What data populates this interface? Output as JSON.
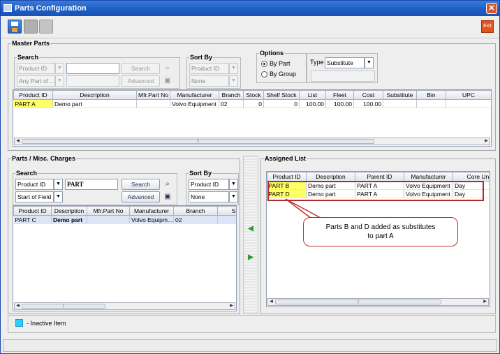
{
  "window": {
    "title": "Parts Configuration",
    "close_glyph": "✕"
  },
  "toolbar": {
    "exit_label": "Exit",
    "icons": [
      "save-icon",
      "print-icon",
      "document-icon"
    ]
  },
  "master": {
    "title": "Master Parts",
    "search": {
      "label": "Search",
      "field": "Product ID",
      "match": "Any Part of ...",
      "value": "",
      "search_btn": "Search",
      "advanced_btn": "Advanced"
    },
    "sort": {
      "label": "Sort By",
      "field": "Product ID",
      "order": "None"
    },
    "options": {
      "label": "Options",
      "by_part": "By Part",
      "by_group": "By Group",
      "type_label": "Type",
      "type_value": "Substitute"
    },
    "columns": [
      "Product ID",
      "Description",
      "Mfr.Part No",
      "Manufacturer",
      "Branch",
      "Stock",
      "Shelf Stock",
      "List",
      "Fleet",
      "Cost",
      "Substitute",
      "Bin",
      "UPC"
    ],
    "rows": [
      [
        "PART A",
        "Demo part",
        "",
        "Volvo Equipment",
        "02",
        "0",
        "0",
        "100.00",
        "100.00",
        "100.00",
        "",
        "",
        ""
      ]
    ]
  },
  "parts": {
    "title": "Parts / Misc. Charges",
    "search": {
      "label": "Search",
      "field": "Product ID",
      "match": "Start of Field",
      "value": "PART",
      "search_btn": "Search",
      "advanced_btn": "Advanced"
    },
    "sort": {
      "label": "Sort By",
      "field": "Product ID",
      "order": "None"
    },
    "columns": [
      "Product ID",
      "Description",
      "Mfr.Part No",
      "Manufacturer",
      "Branch",
      "Sto"
    ],
    "rows": [
      [
        "PART C",
        "Demo part",
        "",
        "Volvo Equipm...",
        "02",
        ""
      ]
    ]
  },
  "assigned": {
    "title": "Assigned List",
    "columns": [
      "Product ID",
      "Description",
      "Parent ID",
      "Manufacturer",
      "Core Un"
    ],
    "rows": [
      [
        "PART B",
        "Demo part",
        "PART A",
        "Volvo Equipment",
        "Day"
      ],
      [
        "PART D",
        "Demo part",
        "PART A",
        "Volvo Equipment",
        "Day"
      ]
    ]
  },
  "callout": {
    "line1": "Parts B and D added as substitutes",
    "line2": "to part A"
  },
  "legend": {
    "text": "- Inactive Item",
    "color": "#33ccff"
  },
  "colors": {
    "highlight": "#ffff66",
    "accent": "#c0302a",
    "title_bar": "#1f5fc6"
  }
}
